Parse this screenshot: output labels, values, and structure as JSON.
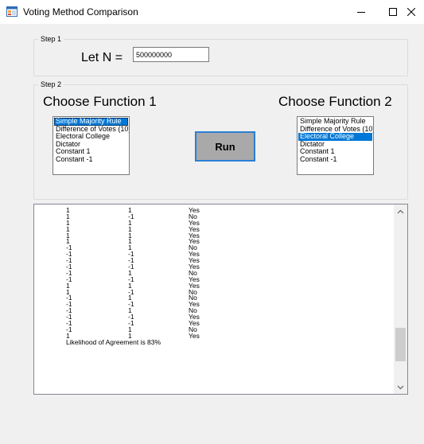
{
  "window": {
    "title": "Voting Method Comparison",
    "controls": {
      "minimize_icon": "minimize-icon",
      "maximize_icon": "maximize-icon",
      "close_icon": "close-icon"
    }
  },
  "step1": {
    "legend": "Step 1",
    "n_label": "Let N =",
    "n_value": "500000000"
  },
  "step2": {
    "legend": "Step 2",
    "function1": {
      "heading": "Choose Function 1",
      "items": [
        "Simple Majority Rule",
        "Difference of Votes (10)",
        "Electoral College",
        "Dictator",
        "Constant 1",
        "Constant -1"
      ],
      "selected": "Simple Majority Rule"
    },
    "function2": {
      "heading": "Choose Function 2",
      "items": [
        "Simple Majority Rule",
        "Difference of Votes (10)",
        "Electoral College",
        "Dictator",
        "Constant 1",
        "Constant -1"
      ],
      "selected": "Electoral College"
    },
    "run_label": "Run"
  },
  "output": {
    "rows": [
      [
        "1",
        "1",
        "Yes"
      ],
      [
        "1",
        "-1",
        "No"
      ],
      [
        "1",
        "1",
        "Yes"
      ],
      [
        "1",
        "1",
        "Yes"
      ],
      [
        "1",
        "1",
        "Yes"
      ],
      [
        "1",
        "1",
        "Yes"
      ],
      [
        "-1",
        "1",
        "No"
      ],
      [
        "-1",
        "-1",
        "Yes"
      ],
      [
        "-1",
        "-1",
        "Yes"
      ],
      [
        "-1",
        "-1",
        "Yes"
      ],
      [
        "-1",
        "1",
        "No"
      ],
      [
        "-1",
        "-1",
        "Yes"
      ],
      [
        "1",
        "1",
        "Yes"
      ],
      [
        "1",
        "-1",
        "No"
      ],
      [
        "-1",
        "1",
        "No"
      ],
      [
        "-1",
        "-1",
        "Yes"
      ],
      [
        "-1",
        "1",
        "No"
      ],
      [
        "-1",
        "-1",
        "Yes"
      ],
      [
        "-1",
        "-1",
        "Yes"
      ],
      [
        "-1",
        "1",
        "No"
      ],
      [
        "1",
        "1",
        "Yes"
      ]
    ],
    "summary": "Likelihood of Agreement is 83%",
    "scroll_fraction": 0.85
  },
  "colors": {
    "selection": "#0078d7",
    "run_border": "#2a7fd4",
    "run_fill": "#a9a9a9"
  }
}
